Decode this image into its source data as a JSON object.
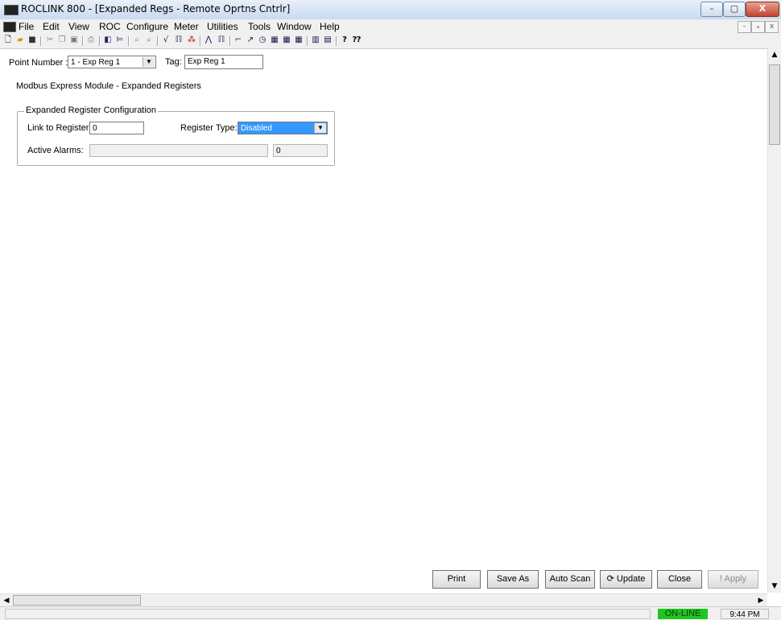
{
  "window": {
    "title": "ROCLINK 800 - [Expanded Regs - Remote Oprtns Cntrlr]",
    "minimize": "–",
    "maximize": "▢",
    "close": "X"
  },
  "menu": [
    "File",
    "Edit",
    "View",
    "ROC",
    "Configure",
    "Meter",
    "Utilities",
    "Tools",
    "Window",
    "Help"
  ],
  "mdi_controls": [
    "-",
    "ₐ",
    "x"
  ],
  "toolbar_icons": [
    "new-icon",
    "open-icon",
    "save-icon",
    "cut-icon",
    "copy-icon",
    "paste-icon",
    "print-icon",
    "connect-icon",
    "tree-icon",
    "zoom-in-icon",
    "zoom-out-icon",
    "chart-icon",
    "io-icon",
    "tool-icon",
    "graph-icon",
    "plot-icon",
    "config-icon",
    "flash-icon",
    "clock-icon",
    "meter-icon",
    "display-icon",
    "display2-icon",
    "report-icon",
    "export-icon",
    "help-icon",
    "context-help-icon"
  ],
  "form": {
    "point_number_label": "Point Number :",
    "point_number_value": "1 - Exp Reg 1",
    "tag_label": "Tag:",
    "tag_value": "Exp Reg 1",
    "heading": "Modbus Express Module - Expanded Registers",
    "group_title": "Expanded Register Configuration",
    "link_label": "Link to Register:",
    "link_value": "0",
    "register_type_label": "Register Type:",
    "register_type_value": "Disabled",
    "active_alarms_label": "Active Alarms:",
    "active_alarms_value": "",
    "active_alarms_code": "0"
  },
  "buttons": {
    "print": "Print",
    "save_as": "Save As",
    "auto_scan": "Auto Scan",
    "update": "Update",
    "close": "Close",
    "apply": "Apply"
  },
  "status": {
    "connection": "ON-LINE",
    "time": "9:44 PM"
  },
  "colors": {
    "online_bg": "#1fc61f",
    "selected_bg": "#3399ff"
  }
}
